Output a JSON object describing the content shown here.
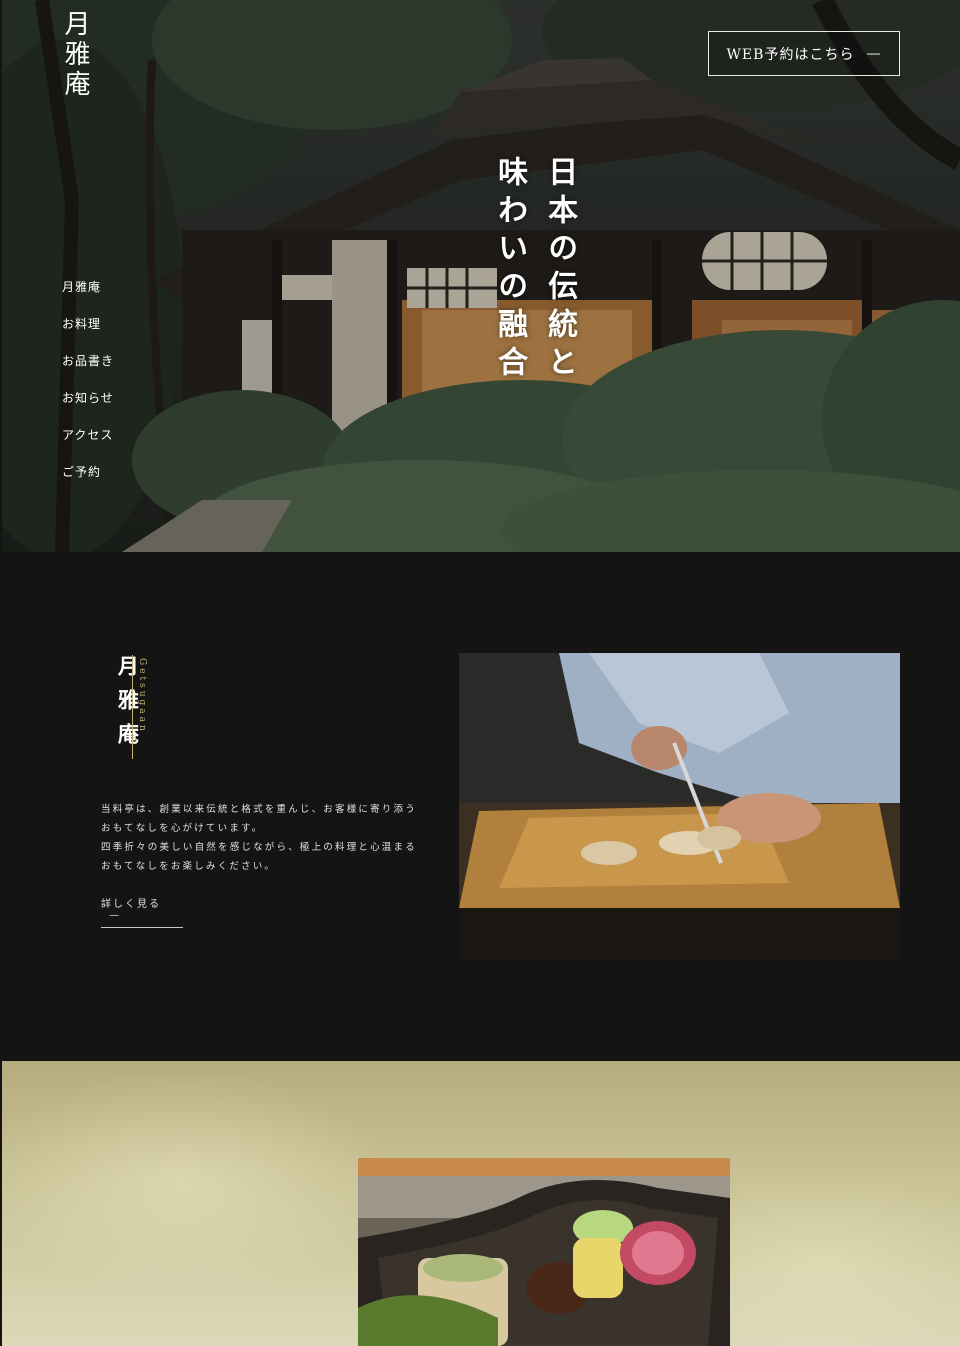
{
  "brand": {
    "logo_text": "月雅庵"
  },
  "nav": {
    "items": [
      {
        "label": "月雅庵"
      },
      {
        "label": "お料理"
      },
      {
        "label": "お品書き"
      },
      {
        "label": "お知らせ"
      },
      {
        "label": "アクセス"
      },
      {
        "label": "ご予約"
      }
    ]
  },
  "header": {
    "reserve_label": "WEB予約はこちら",
    "reserve_arrow": "—"
  },
  "hero": {
    "copy_line1": "日本の伝統と",
    "copy_line2": "味わいの融合"
  },
  "about": {
    "title": "月雅庵",
    "title_roman": "Getsugaan",
    "text_line1": "当料亭は、創業以来伝統と格式を重んじ、お客様に寄り添う",
    "text_line2": "おもてなしを心がけています。",
    "text_line3": "四季折々の美しい自然を感じながら、極上の料理と心温まる",
    "text_line4": "おもてなしをお楽しみください。",
    "more_label": "詳しく見る",
    "more_arrow": "—"
  },
  "colors": {
    "dark_bg": "#141414",
    "accent_gold": "#c8b070",
    "food_bg": "#c8c194"
  }
}
